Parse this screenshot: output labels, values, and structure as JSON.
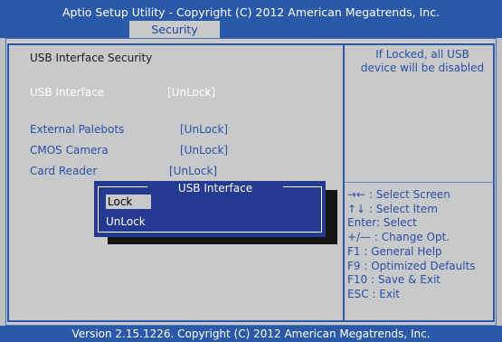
{
  "header": {
    "title": "Aptio Setup Utility - Copyright (C) 2012 American Megatrends, Inc.",
    "active_tab": "Security"
  },
  "main": {
    "section_title": "USB Interface Security",
    "settings": [
      {
        "label": "USB Interface",
        "value": "[UnLock]"
      },
      {
        "label": "External Palebots",
        "value": "[UnLock]"
      },
      {
        "label": "CMOS Camera",
        "value": "[UnLock]"
      },
      {
        "label": "Card Reader",
        "value": "[UnLock]"
      }
    ]
  },
  "help": {
    "description": "If Locked, all USB device will be disabled",
    "keys": [
      "→←  : Select Screen",
      "↑↓  : Select Item",
      "Enter: Select",
      "+/—  : Change Opt.",
      "F1   : General Help",
      "F9   : Optimized Defaults",
      "F10  : Save & Exit",
      "ESC  : Exit"
    ]
  },
  "popup": {
    "title": "USB Interface",
    "options": [
      "Lock",
      "UnLock"
    ],
    "selected": "Lock"
  },
  "footer": {
    "version": "Version 2.15.1226. Copyright (C) 2012 American Megatrends, Inc."
  },
  "colors": {
    "header_blue": "#2b59a9",
    "panel_gray": "#c8c9cb",
    "text_blue": "#2a4fa3",
    "popup_blue": "#243a90"
  }
}
